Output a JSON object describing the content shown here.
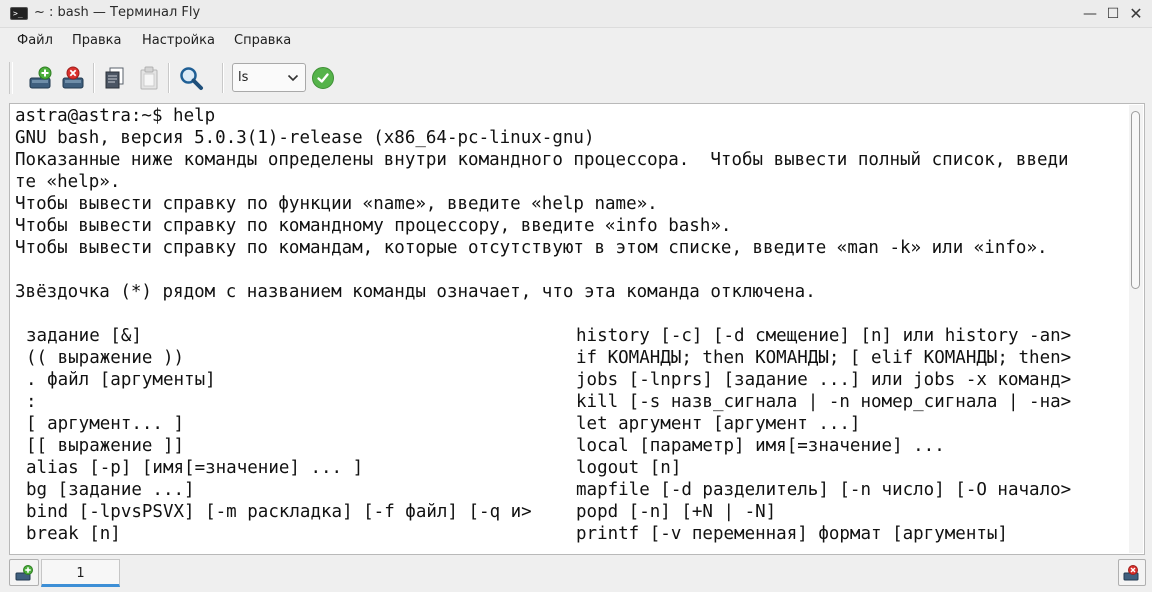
{
  "window": {
    "title": "~ : bash — Терминал Fly",
    "app_icon_glyph": ">_",
    "minimize_glyph": "—",
    "maximize_glyph": "☐",
    "close_glyph": "✕"
  },
  "menu": {
    "items": [
      "Файл",
      "Правка",
      "Настройка",
      "Справка"
    ]
  },
  "toolbar": {
    "icons": [
      "new-tab-icon",
      "close-tab-icon",
      "copy-icon",
      "paste-icon",
      "search-icon"
    ],
    "command_value": "ls",
    "execute_icon": "checkmark-icon",
    "accent_color": "#55b34a"
  },
  "terminal": {
    "lines": [
      "astra@astra:~$ help",
      "GNU bash, версия 5.0.3(1)-release (x86_64-pc-linux-gnu)",
      "Показанные ниже команды определены внутри командного процессора.  Чтобы вывести полный список, введи",
      "те «help».",
      "Чтобы вывести справку по функции «name», введите «help name».",
      "Чтобы вывести справку по командному процессору, введите «info bash».",
      "Чтобы вывести справку по командам, которые отсутствуют в этом списке, введите «man -k» или «info».",
      "",
      "Звёздочка (*) рядом с названием команды означает, что эта команда отключена.",
      ""
    ],
    "left_column": [
      "задание [&]",
      "(( выражение ))",
      ". файл [аргументы]",
      ":",
      "[ аргумент... ]",
      "[[ выражение ]]",
      "alias [-p] [имя[=значение] ... ]",
      "bg [задание ...]",
      "bind [-lpvsPSVX] [-m раскладка] [-f файл] [-q и>",
      "break [n]"
    ],
    "right_column": [
      "history [-c] [-d смещение] [n] или history -an>",
      "if КОМАНДЫ; then КОМАНДЫ; [ elif КОМАНДЫ; then>",
      "jobs [-lnprs] [задание ...] или jobs -x команд>",
      "kill [-s назв_сигнала | -n номер_сигнала | -на>",
      "let аргумент [аргумент ...]",
      "local [параметр] имя[=значение] ...",
      "logout [n]",
      "mapfile [-d разделитель] [-n число] [-O начало>",
      "popd [-n] [+N | -N]",
      "printf [-v переменная] формат [аргументы]"
    ]
  },
  "tabs": {
    "items": [
      {
        "label": "1"
      }
    ],
    "active_color": "#3d8fd6"
  }
}
